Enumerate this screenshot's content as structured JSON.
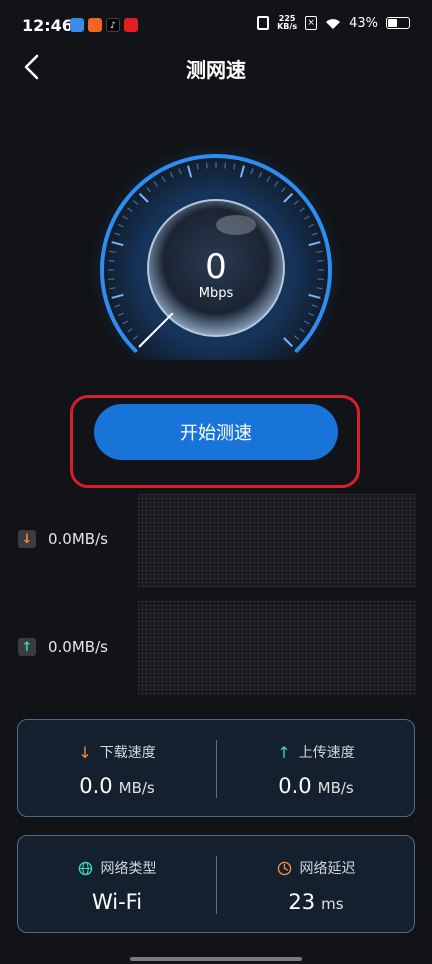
{
  "status_bar": {
    "time": "12:46",
    "network_speed_value": "225",
    "network_speed_unit": "KB/s",
    "battery": "43%"
  },
  "header": {
    "title": "测网速"
  },
  "gauge": {
    "value": "0",
    "unit": "Mbps"
  },
  "actions": {
    "start_label": "开始测速"
  },
  "realtime": {
    "download": "0.0MB/s",
    "upload": "0.0MB/s"
  },
  "stats": {
    "download_label": "下载速度",
    "download_value": "0.0",
    "download_unit": "MB/s",
    "upload_label": "上传速度",
    "upload_value": "0.0",
    "upload_unit": "MB/s"
  },
  "network": {
    "type_label": "网络类型",
    "type_value": "Wi-Fi",
    "latency_label": "网络延迟",
    "latency_value": "23",
    "latency_unit": "ms"
  },
  "colors": {
    "accent": "#1874d8",
    "download_arrow": "#f08a3c",
    "upload_arrow": "#3fd3b0",
    "highlight_frame": "#d6202b"
  },
  "icons": [
    "back-chevron-icon",
    "down-arrow-icon",
    "up-arrow-icon",
    "globe-icon",
    "clock-icon"
  ]
}
